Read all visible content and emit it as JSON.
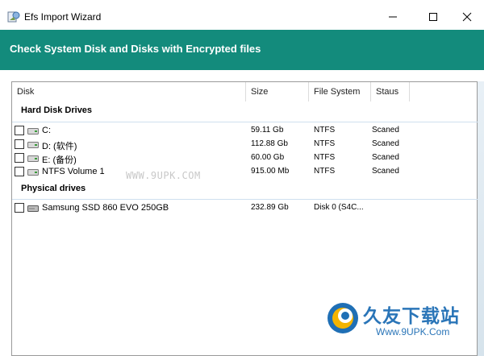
{
  "window": {
    "title": "Efs Import Wizard",
    "app_icon": "wizard-app-icon",
    "controls": [
      "minimize-icon",
      "maximize-icon",
      "close-icon"
    ]
  },
  "header": {
    "title": "Check System Disk and Disks with Encrypted files",
    "background": "#138b7c"
  },
  "listview": {
    "columns": [
      "Disk",
      "Size",
      "File System",
      "Staus"
    ],
    "groups": [
      {
        "label": "Hard Disk Drives",
        "rows": [
          {
            "checked": false,
            "icon": "hard-drive-icon",
            "name": "C:",
            "size": "59.11 Gb",
            "fs": "NTFS",
            "status": "Scaned"
          },
          {
            "checked": false,
            "icon": "hard-drive-icon",
            "name": "D: (软件)",
            "size": "112.88 Gb",
            "fs": "NTFS",
            "status": "Scaned"
          },
          {
            "checked": false,
            "icon": "hard-drive-icon",
            "name": "E: (备份)",
            "size": "60.00 Gb",
            "fs": "NTFS",
            "status": "Scaned"
          },
          {
            "checked": false,
            "icon": "hard-drive-icon",
            "name": "NTFS Volume 1",
            "size": "915.00 Mb",
            "fs": "NTFS",
            "status": "Scaned"
          }
        ]
      },
      {
        "label": "Physical drives",
        "rows": [
          {
            "checked": false,
            "icon": "physical-drive-icon",
            "name": "Samsung SSD 860 EVO 250GB",
            "size": "232.89 Gb",
            "fs": "Disk 0 (S4C...",
            "status": ""
          }
        ]
      }
    ]
  },
  "watermark": {
    "center_text": "WWW.9UPK.COM",
    "brand": "久友下载站",
    "url": "Www.9UPK.Com",
    "brand_color": "#2a75b8"
  }
}
